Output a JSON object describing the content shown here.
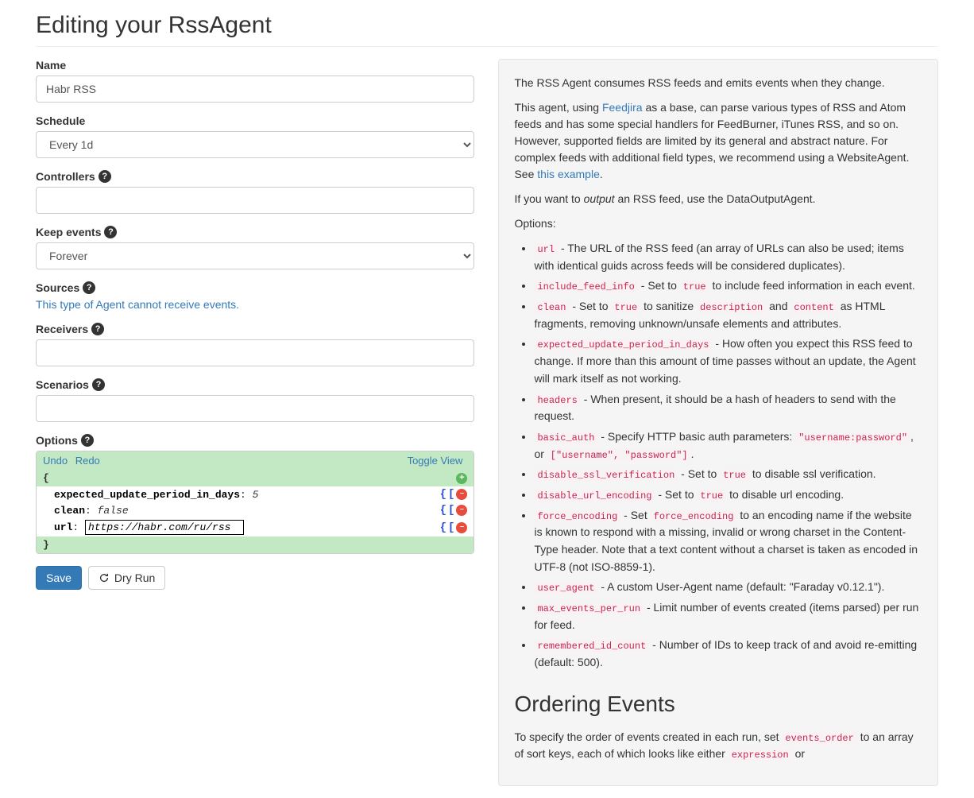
{
  "title": "Editing your RssAgent",
  "form": {
    "name_label": "Name",
    "name_value": "Habr RSS",
    "schedule_label": "Schedule",
    "schedule_value": "Every 1d",
    "controllers_label": "Controllers",
    "keep_events_label": "Keep events",
    "keep_events_value": "Forever",
    "sources_label": "Sources",
    "sources_note": "This type of Agent cannot receive events.",
    "receivers_label": "Receivers",
    "scenarios_label": "Scenarios",
    "options_label": "Options",
    "undo": "Undo",
    "redo": "Redo",
    "toggle_view": "Toggle View",
    "json": {
      "k1": "expected_update_period_in_days",
      "v1": "5",
      "k2": "clean",
      "v2": "false",
      "k3": "url",
      "v3": "https://habr.com/ru/rss"
    },
    "save": "Save",
    "dry_run": "Dry Run"
  },
  "help": {
    "p1": "The RSS Agent consumes RSS feeds and emits events when they change.",
    "p2a": "This agent, using ",
    "p2_link": "Feedjira",
    "p2b": " as a base, can parse various types of RSS and Atom feeds and has some special handlers for FeedBurner, iTunes RSS, and so on. However, supported fields are limited by its general and abstract nature. For complex feeds with additional field types, we recommend using a WebsiteAgent. See ",
    "p2_link2": "this example",
    "p3a": "If you want to ",
    "p3_em": "output",
    "p3b": " an RSS feed, use the DataOutputAgent.",
    "opts_label": "Options:",
    "opts": {
      "url": {
        "c": "url",
        "t": " - The URL of the RSS feed (an array of URLs can also be used; items with identical guids across feeds will be considered duplicates)."
      },
      "include": {
        "c": "include_feed_info",
        "t1": " - Set to ",
        "c2": "true",
        "t2": " to include feed information in each event."
      },
      "clean": {
        "c": "clean",
        "t1": " - Set to ",
        "c2": "true",
        "t2": " to sanitize ",
        "c3": "description",
        "t3": " and ",
        "c4": "content",
        "t4": " as HTML fragments, removing unknown/unsafe elements and attributes."
      },
      "expected": {
        "c": "expected_update_period_in_days",
        "t": " - How often you expect this RSS feed to change. If more than this amount of time passes without an update, the Agent will mark itself as not working."
      },
      "headers": {
        "c": "headers",
        "t": " - When present, it should be a hash of headers to send with the request."
      },
      "basic": {
        "c": "basic_auth",
        "t1": " - Specify HTTP basic auth parameters: ",
        "c2": "\"username:password\"",
        "t2": ", or ",
        "c3": "[\"username\", \"password\"]",
        "t3": "."
      },
      "dssl": {
        "c": "disable_ssl_verification",
        "t1": " - Set to ",
        "c2": "true",
        "t2": " to disable ssl verification."
      },
      "durl": {
        "c": "disable_url_encoding",
        "t1": " - Set to ",
        "c2": "true",
        "t2": " to disable url encoding."
      },
      "fenc": {
        "c": "force_encoding",
        "t1": " - Set ",
        "c2": "force_encoding",
        "t2": " to an encoding name if the website is known to respond with a missing, invalid or wrong charset in the Content-Type header. Note that a text content without a charset is taken as encoded in UTF-8 (not ISO-8859-1)."
      },
      "ua": {
        "c": "user_agent",
        "t": " - A custom User-Agent name (default: \"Faraday v0.12.1\")."
      },
      "max": {
        "c": "max_events_per_run",
        "t": " - Limit number of events created (items parsed) per run for feed."
      },
      "rem": {
        "c": "remembered_id_count",
        "t": " - Number of IDs to keep track of and avoid re-emitting (default: 500)."
      }
    },
    "ordering_heading": "Ordering Events",
    "ord_p1a": "To specify the order of events created in each run, set ",
    "ord_c1": "events_order",
    "ord_p1b": " to an array of sort keys, each of which looks like either ",
    "ord_c2": "expression",
    "ord_p1c": " or"
  }
}
